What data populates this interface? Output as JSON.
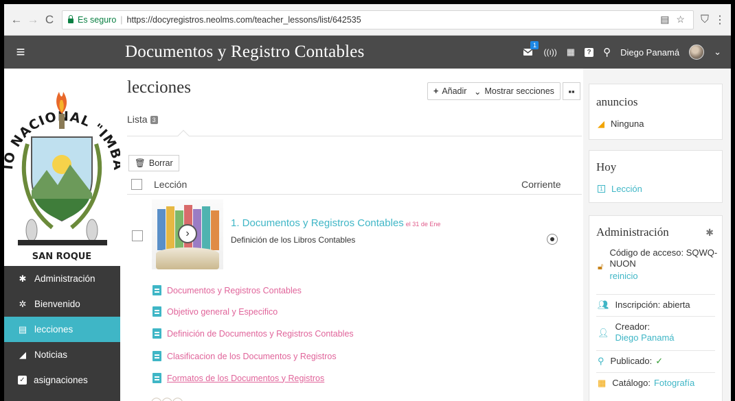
{
  "browser": {
    "secure_label": "Es seguro",
    "url": "https://docyregistros.neolms.com/teacher_lessons/list/642535"
  },
  "header": {
    "title": "Documentos y Registro Contables",
    "notification_count": "1",
    "user_name": "Diego Panamá"
  },
  "logo": {
    "arc_text": "COLEGIO NACIONAL \"IMBABURA\"",
    "bottom_text": "SAN ROQUE"
  },
  "sidebar": {
    "items": [
      {
        "label": "Administración",
        "icon": "gear-icon"
      },
      {
        "label": "Bienvenido",
        "icon": "sparkle-icon"
      },
      {
        "label": "lecciones",
        "icon": "lessons-icon",
        "active": true
      },
      {
        "label": "Noticias",
        "icon": "bell-icon"
      },
      {
        "label": "asignaciones",
        "icon": "check-icon"
      }
    ]
  },
  "main": {
    "title": "lecciones",
    "tab_label": "Lista",
    "tab_count": "3",
    "add_label": "Añadir",
    "show_sections_label": "Mostrar secciones",
    "delete_label": "Borrar",
    "col_lesson": "Lección",
    "col_current": "Corriente",
    "lessons": [
      {
        "title": "1. Documentos y Registros Contables",
        "date": "el 31 de Ene",
        "description": "Definición de los Libros Contables",
        "current": true
      }
    ],
    "resources": [
      "Documentos y Registros Contables",
      "Objetivo general y Especifico",
      "Definición de Documentos y Registros Contables",
      "Clasificacion de los Documentos y Registros",
      "Formatos de los Documentos y Registros"
    ]
  },
  "announcements": {
    "title": "anuncios",
    "item": "Ninguna"
  },
  "today": {
    "title": "Hoy",
    "item": "Lección"
  },
  "admin": {
    "title": "Administración",
    "access_code_label": "Código de acceso: SQWQ-NUON",
    "reset_link": "reinicio",
    "enrollment": "Inscripción: abierta",
    "creator_label": "Creador:",
    "creator_name": "Diego Panamá",
    "published_label": "Publicado:",
    "published_mark": "✓",
    "catalog_label": "Catálogo:",
    "catalog_value": "Fotografía"
  },
  "colors": {
    "accent": "#3fb6c6",
    "link_pink": "#e0649a",
    "sidebar_bg": "#3a3a3a",
    "header_bg": "#4a4a4a"
  }
}
